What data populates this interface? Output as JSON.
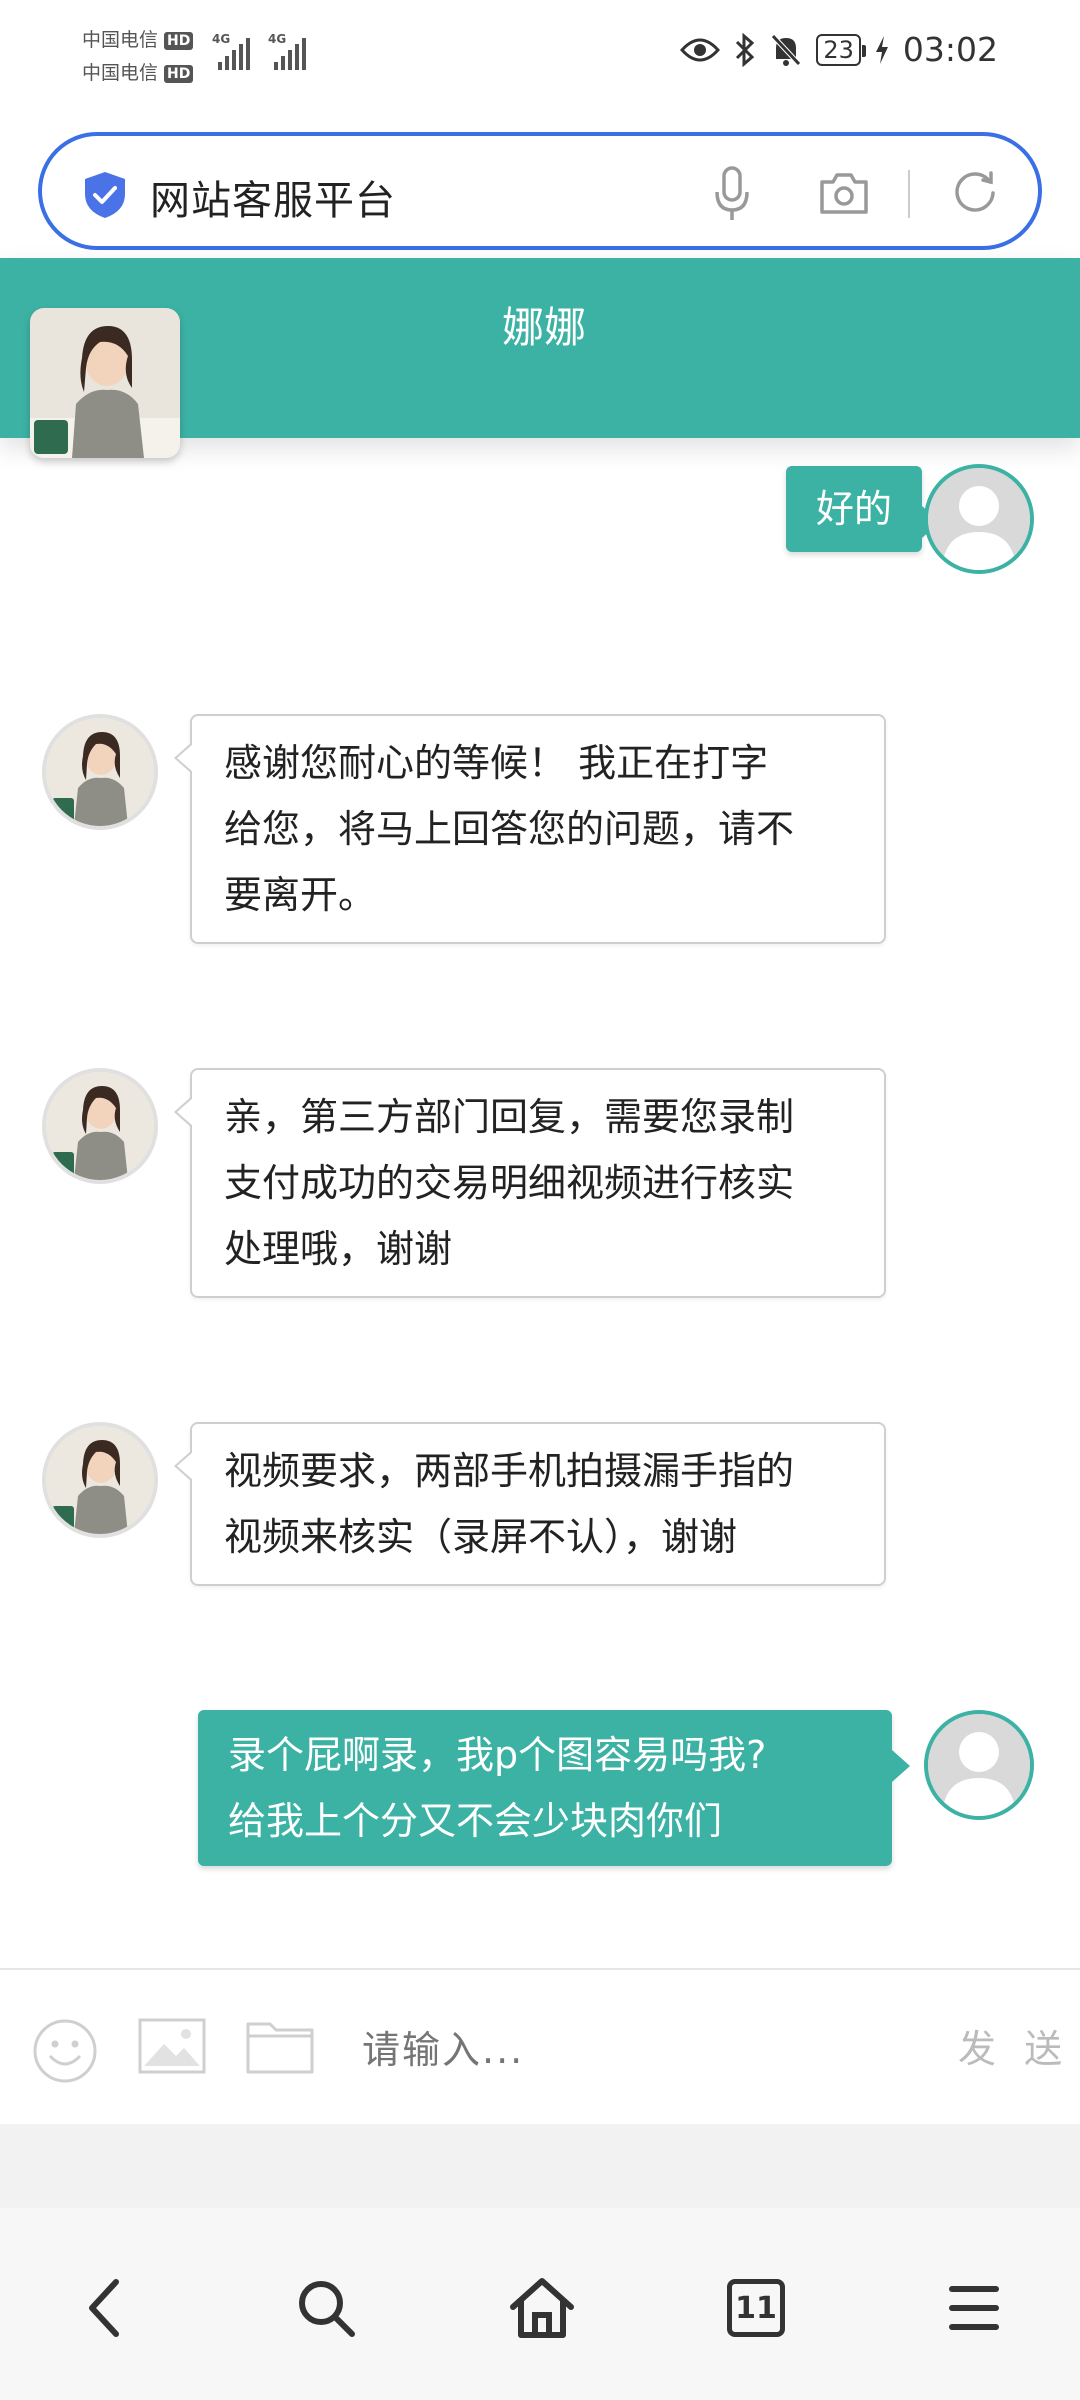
{
  "status_bar": {
    "carrier1": "中国电信",
    "carrier2": "中国电信",
    "hd_label": "HD",
    "net_label": "4G",
    "battery": "23",
    "time": "03:02"
  },
  "url_bar": {
    "title": "网站客服平台",
    "accent_color": "#3a6fe6"
  },
  "chat": {
    "agent_name": "娜娜",
    "theme_color": "#3cb2a4",
    "messages": [
      {
        "sender": "user",
        "text": "好的"
      },
      {
        "sender": "agent",
        "lines": [
          "感谢您耐心的等候！ 我正在打字",
          "给您，将马上回答您的问题，请不",
          "要离开。"
        ]
      },
      {
        "sender": "agent",
        "lines": [
          "亲，第三方部门回复，需要您录制",
          "支付成功的交易明细视频进行核实",
          "处理哦，谢谢"
        ]
      },
      {
        "sender": "agent",
        "lines": [
          "视频要求，两部手机拍摄漏手指的",
          "视频来核实（录屏不认），谢谢"
        ]
      },
      {
        "sender": "user",
        "lines": [
          "录个屁啊录，我p个图容易吗我?",
          "给我上个分又不会少块肉你们"
        ]
      }
    ]
  },
  "input": {
    "placeholder": "请输入...",
    "send_label": "发 送"
  },
  "bottom_nav": {
    "tab_count": "11"
  }
}
